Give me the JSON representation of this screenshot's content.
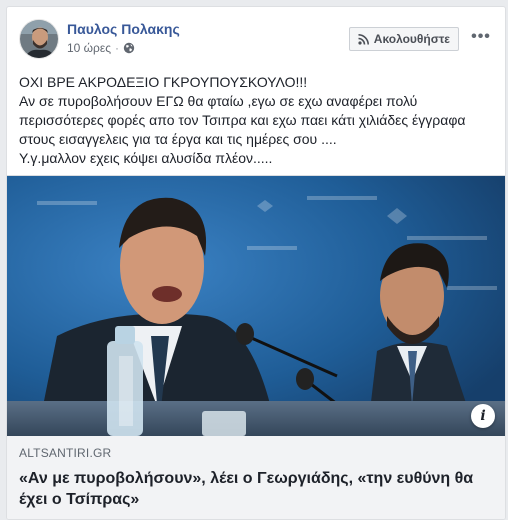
{
  "post": {
    "author": "Παυλος Πολακης",
    "timestamp": "10 ώρες",
    "separator": "·",
    "privacy_icon": "globe-icon",
    "follow_label": "Ακολουθήστε",
    "follow_icon": "rss-icon",
    "more_icon": "more-options-icon",
    "more_label": "•••",
    "text_lines": [
      "ΟΧΙ ΒΡΕ ΑΚΡΟΔΕΞΙΟ ΓΚΡΟΥΠΟΥΣΚΟΥΛΟ!!!",
      "Αν σε πυροβολήσουν ΕΓΩ θα φταίω ,εγω σε εχω αναφέρει πολύ",
      "περισσότερες φορές απο τον Τσιπρα και εχω παει κάτι χιλιάδες έγγραφα",
      "στους εισαγγελεις για τα έργα και τις ημέρες σου ....",
      "Υ.γ.μαλλον εχεις κόψει αλυσίδα πλέον....."
    ]
  },
  "link_preview": {
    "domain": "ALTSANTIRI.GR",
    "headline": "«Αν με πυροβολήσουν», λέει ο Γεωργιάδης, «την ευθύνη θα έχει ο Τσίπρας»",
    "info_label": "i"
  },
  "colors": {
    "author_link": "#385898",
    "card_bg": "#ffffff",
    "preview_bg": "#f2f3f5",
    "photo_backdrop": "#1e5a92"
  }
}
